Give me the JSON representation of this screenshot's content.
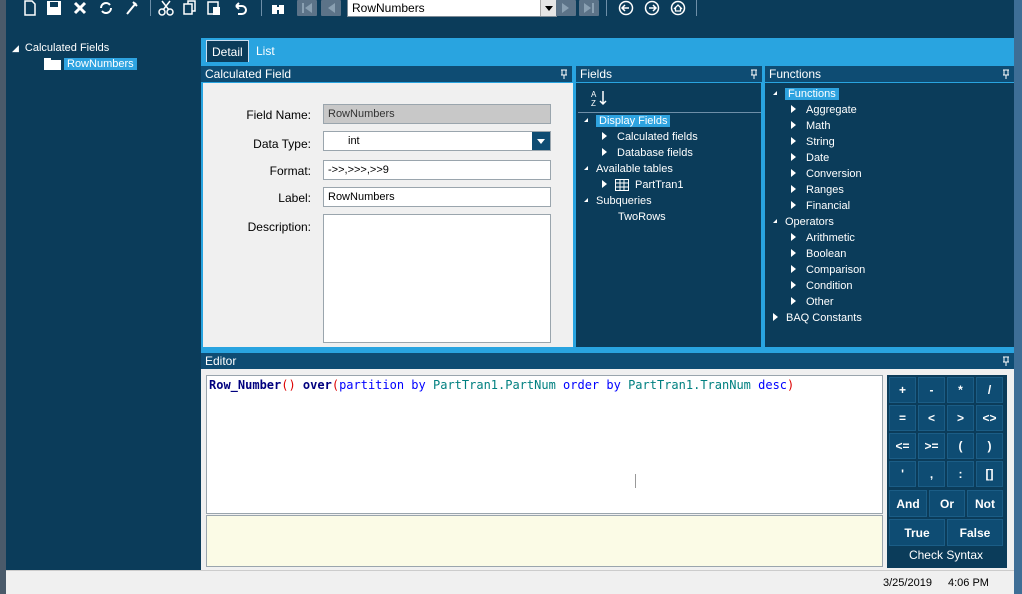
{
  "toolbar": {
    "record_selector_value": "RowNumbers",
    "buttons": [
      "new-icon",
      "save-icon",
      "delete-icon",
      "refresh-icon",
      "clear-icon",
      "cut-icon",
      "copy-icon",
      "paste-icon",
      "undo-icon",
      "binoculars-icon",
      "first-icon",
      "prev-icon",
      "next-icon",
      "last-icon",
      "back-icon",
      "forward-icon",
      "home-icon"
    ]
  },
  "tree": {
    "root_label": "Calculated Fields",
    "child_label": "RowNumbers"
  },
  "tabs": {
    "detail": "Detail",
    "list": "List"
  },
  "calculated_field": {
    "header": "Calculated Field",
    "field_name_label": "Field Name:",
    "field_name_value": "RowNumbers",
    "data_type_label": "Data Type:",
    "data_type_value": "int",
    "format_label": "Format:",
    "format_value": "->>,>>>,>>9",
    "label_label": "Label:",
    "label_value": "RowNumbers",
    "description_label": "Description:",
    "description_value": ""
  },
  "fields_panel": {
    "header": "Fields",
    "display_fields": "Display Fields",
    "calculated_fields": "Calculated fields",
    "database_fields": "Database fields",
    "available_tables": "Available tables",
    "parttran1": "PartTran1",
    "subqueries": "Subqueries",
    "tworows": "TwoRows"
  },
  "functions_panel": {
    "header": "Functions",
    "functions_root": "Functions",
    "aggregate": "Aggregate",
    "math": "Math",
    "string": "String",
    "date": "Date",
    "conversion": "Conversion",
    "ranges": "Ranges",
    "financial": "Financial",
    "operators": "Operators",
    "arithmetic": "Arithmetic",
    "boolean": "Boolean",
    "comparison": "Comparison",
    "condition": "Condition",
    "other": "Other",
    "baq_constants": "BAQ Constants"
  },
  "editor": {
    "header": "Editor",
    "code_parts": {
      "fn": "Row_Number",
      "paren1": "()",
      "over": " over",
      "open": "(",
      "partition": "partition by",
      "col1": " PartTran1.PartNum",
      "order": " order by",
      "col2": " PartTran1.TranNum",
      "desc": " desc",
      "close": ")"
    }
  },
  "keypad": {
    "plus": "+",
    "minus": "-",
    "times": "*",
    "divide": "/",
    "eq": "=",
    "lt": "<",
    "gt": ">",
    "ne": "<>",
    "le": "<=",
    "ge": ">=",
    "lparen": "(",
    "rparen": ")",
    "quote": "'",
    "comma": ",",
    "colon": ":",
    "brackets": "[]",
    "and": "And",
    "or": "Or",
    "not": "Not",
    "true": "True",
    "false": "False",
    "check_syntax": "Check Syntax"
  },
  "status": {
    "date": "3/25/2019",
    "time": "4:06 PM"
  },
  "colors": {
    "dark_panel": "#0b3c5a",
    "accent": "#29a4e0",
    "selected": "#2ea3e0"
  }
}
